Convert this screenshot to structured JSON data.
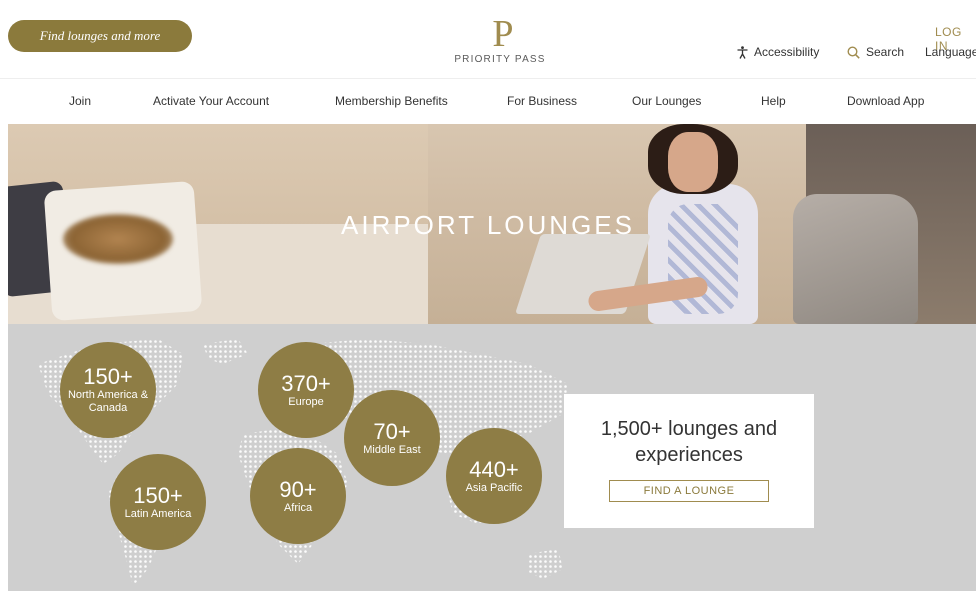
{
  "header": {
    "find_button": "Find lounges and more",
    "logo_mark": "P",
    "logo_text": "PRIORITY PASS",
    "login": "LOG IN",
    "accessibility": "Accessibility",
    "search": "Search",
    "language": "Language"
  },
  "nav": {
    "items": [
      "Join",
      "Activate Your Account",
      "Membership Benefits",
      "For Business",
      "Our Lounges",
      "Help",
      "Download App"
    ]
  },
  "hero": {
    "title": "AIRPORT LOUNGES"
  },
  "regions": [
    {
      "count": "150+",
      "name": "North America & Canada"
    },
    {
      "count": "370+",
      "name": "Europe"
    },
    {
      "count": "70+",
      "name": "Middle East"
    },
    {
      "count": "440+",
      "name": "Asia Pacific"
    },
    {
      "count": "150+",
      "name": "Latin America"
    },
    {
      "count": "90+",
      "name": "Africa"
    }
  ],
  "cta": {
    "text": "1,500+ lounges and experiences",
    "button": "FIND A LOUNGE"
  },
  "colors": {
    "gold": "#8e7d45",
    "accent": "#a08c4f"
  },
  "icons": {
    "accessibility": "accessibility-icon",
    "search": "search-icon"
  }
}
